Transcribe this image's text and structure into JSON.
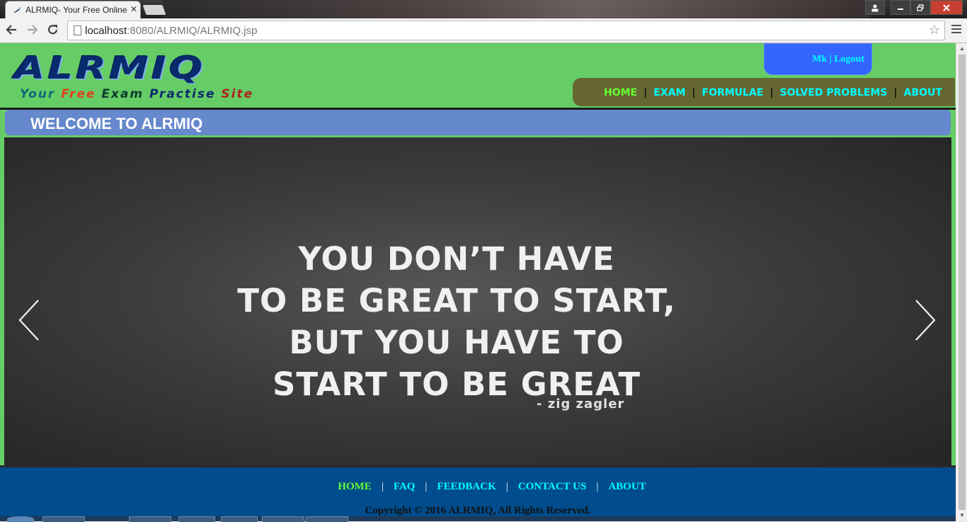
{
  "browser": {
    "tab_title": "ALRMIQ- Your Free Online",
    "tab_close": "✕",
    "url_host": "localhost",
    "url_rest": ":8080/ALRMIQ/ALRMIQ.jsp",
    "back_icon": "🡐",
    "forward_icon": "🡒",
    "reload_icon": "↻",
    "star_icon": "☆"
  },
  "header": {
    "logo_text": "ALRMIQ",
    "tagline": [
      {
        "text": "Your ",
        "color": "#0a6a7a"
      },
      {
        "text": "Free ",
        "color": "#e0401a"
      },
      {
        "text": "Exam ",
        "color": "#0a3a2a"
      },
      {
        "text": "Practise ",
        "color": "#0a2a6e"
      },
      {
        "text": "Site",
        "color": "#b02020"
      }
    ],
    "user": {
      "name": "Mk",
      "separator": "|",
      "logout": "Logout"
    }
  },
  "nav": {
    "items": [
      {
        "label": "HOME",
        "active": true
      },
      {
        "label": "EXAM",
        "active": false
      },
      {
        "label": "FORMULAE",
        "active": false
      },
      {
        "label": "SOLVED PROBLEMS",
        "active": false
      },
      {
        "label": "ABOUT",
        "active": false
      }
    ]
  },
  "welcome": {
    "title": "WELCOME TO ALRMIQ"
  },
  "carousel": {
    "quote_lines": [
      "YOU DON’T HAVE",
      "TO BE GREAT TO START,",
      "BUT YOU HAVE TO",
      "START TO BE GREAT"
    ],
    "author": "- zig zagler",
    "prev_icon": "chevron-left-icon",
    "next_icon": "chevron-right-icon"
  },
  "footer": {
    "links": [
      {
        "label": "HOME",
        "active": true
      },
      {
        "label": "FAQ",
        "active": false
      },
      {
        "label": "FEEDBACK",
        "active": false
      },
      {
        "label": "CONTACT US",
        "active": false
      },
      {
        "label": "ABOUT",
        "active": false
      }
    ],
    "copyright": "Copyright © 2016 ALRMIQ, All Rights Reserved."
  },
  "colors": {
    "page_green": "#66cc66",
    "nav_bg": "#666633",
    "link_cyan": "#00ffff",
    "link_active": "#66ff33",
    "welcome_bar": "#6688cc",
    "footer_bg": "#004c8c",
    "user_box": "#3366ff"
  }
}
